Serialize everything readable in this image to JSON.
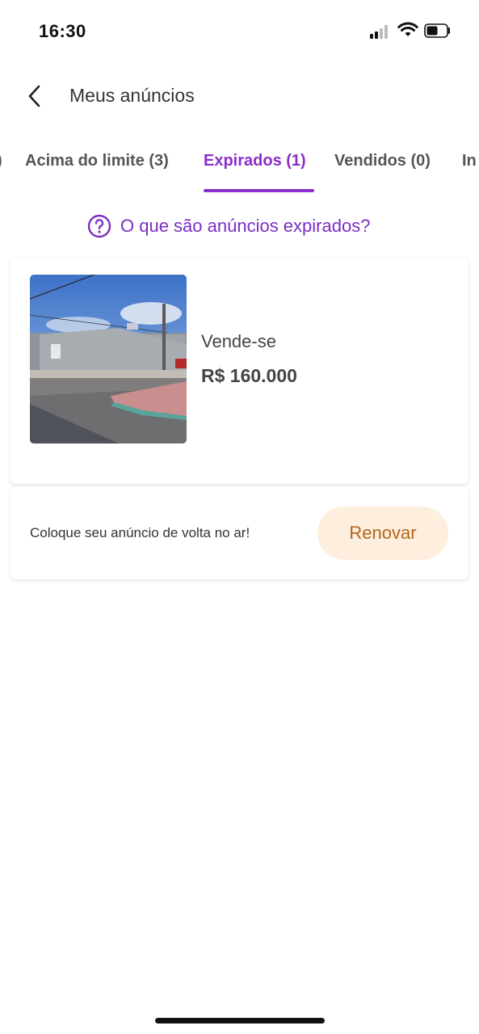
{
  "status_bar": {
    "time": "16:30",
    "icons": [
      "cellular-signal-icon",
      "wifi-icon",
      "battery-icon"
    ]
  },
  "header": {
    "back_icon": "chevron-left-icon",
    "title": "Meus anúncios"
  },
  "tabs": [
    {
      "label": ")",
      "active": false
    },
    {
      "label": "Acima do limite (3)",
      "active": false
    },
    {
      "label": "Expirados (1)",
      "active": true
    },
    {
      "label": "Vendidos (0)",
      "active": false
    },
    {
      "label": "In",
      "active": false
    }
  ],
  "help": {
    "icon": "question-circle-icon",
    "text": "O que são anúncios expirados?"
  },
  "listing": {
    "photo_icon": "house-photo",
    "title": "Vende-se",
    "price": "R$ 160.000"
  },
  "renew": {
    "message": "Coloque seu anúncio de volta no ar!",
    "button_label": "Renovar"
  },
  "colors": {
    "accent": "#8a2fc9",
    "renew_bg": "#fdeedd",
    "renew_text": "#b4661a"
  }
}
